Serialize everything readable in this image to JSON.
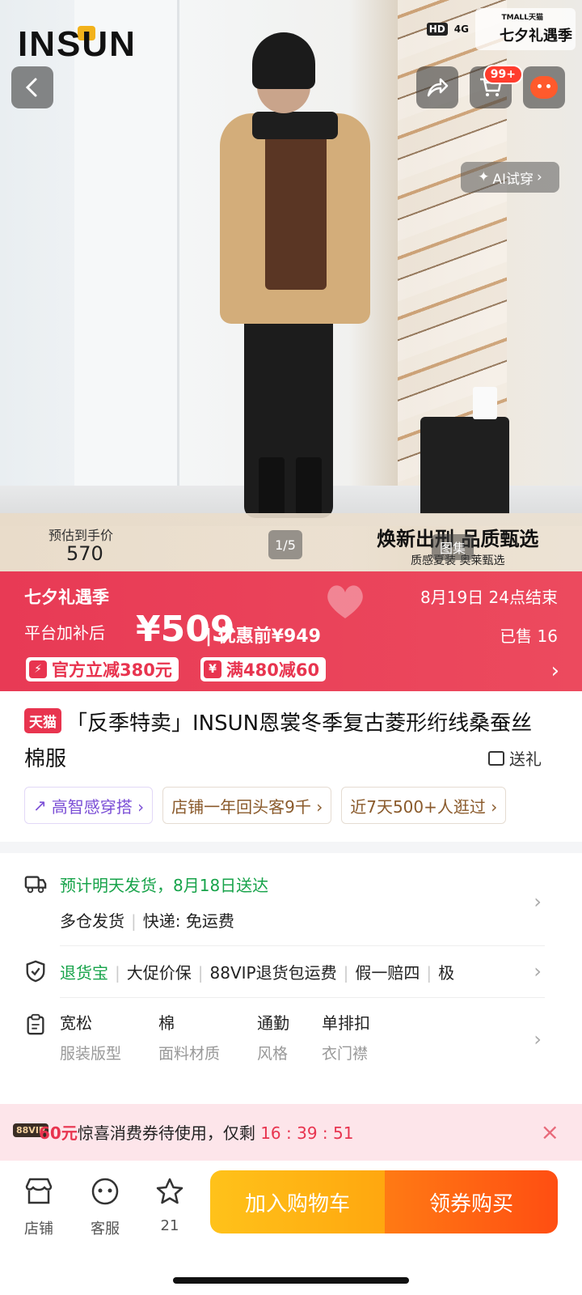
{
  "status_bar": {
    "network": "4G",
    "hd": "HD"
  },
  "hero": {
    "brand": "INSUN",
    "event_small": "TMALL天猫",
    "event_name": "七夕礼遇季",
    "cart_count": "99+",
    "ai_try": "AI试穿",
    "estimated_label": "预估到手价",
    "estimated_price": "570",
    "page_indicator": "1/5",
    "gallery_tab": "图集",
    "slogan": "焕新出刑 品质甄选",
    "slogan_sub": "质感夏装 奥莱甄选"
  },
  "promo": {
    "event": "七夕礼遇季",
    "ends": "8月19日 24点结束",
    "after_label": "平台加补后",
    "price": "¥509",
    "before_price": "| 优惠前¥949",
    "sold": "已售 16",
    "coupon_1": "官方立减380元",
    "coupon_2": "满480减60",
    "chevron": "›"
  },
  "product": {
    "platform_tag": "天猫",
    "title": "「反季特卖」INSUN恩裳冬季复古菱形绗线桑蚕丝棉服",
    "gift": "送礼",
    "chips": [
      "高智感穿搭 ›",
      "店铺一年回头客9千 ›",
      "近7天500+人逛过 ›"
    ]
  },
  "shipping": {
    "main": "预计明天发货，8月18日送达",
    "sub_1": "多仓发货",
    "sub_2": "快递: 免运费"
  },
  "services": [
    "退货宝",
    "大促价保",
    "88VIP退货包运费",
    "假一赔四",
    "极"
  ],
  "attributes": [
    {
      "value": "宽松",
      "label": "服装版型"
    },
    {
      "value": "棉",
      "label": "面料材质"
    },
    {
      "value": "通勤",
      "label": "风格"
    },
    {
      "value": "单排扣",
      "label": "衣门襟"
    }
  ],
  "vip_banner": {
    "badge": "88VIP",
    "amount": "60元",
    "text": "惊喜消费券待使用，仅剩",
    "timer": "16 : 39 : 51",
    "close": "×"
  },
  "bottom_bar": {
    "store": "店铺",
    "service": "客服",
    "favorites": "21",
    "add_to_cart": "加入购物车",
    "buy": "领券购买"
  },
  "colors": {
    "accent": "#e8344f",
    "cart_button": "#ffb414",
    "buy_button": "#ff5a12",
    "green": "#17a34a"
  }
}
